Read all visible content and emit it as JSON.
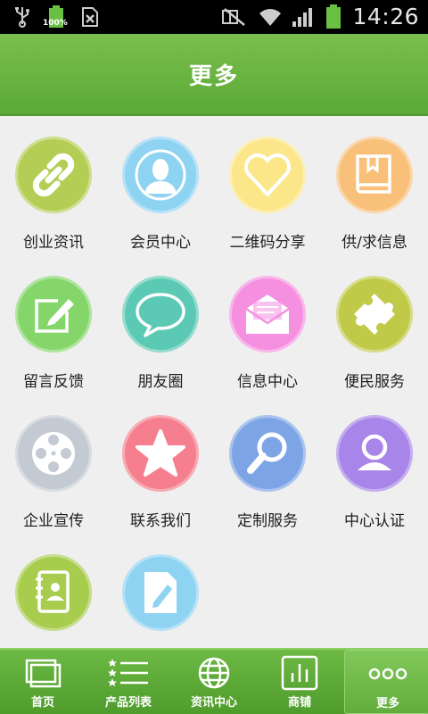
{
  "status_bar": {
    "time": "14:26",
    "battery_label": "100%",
    "icons": [
      "usb-icon",
      "battery-full-icon",
      "sim-card-icon",
      "mute-icon",
      "wifi-icon",
      "signal-icon",
      "battery-icon"
    ]
  },
  "header": {
    "title": "更多"
  },
  "grid": {
    "items": [
      {
        "label": "创业资讯",
        "icon": "chain-link-icon",
        "color": "#b4cd54"
      },
      {
        "label": "会员中心",
        "icon": "user-silhouette-icon",
        "color": "#8fd3f2"
      },
      {
        "label": "二维码分享",
        "icon": "heart-icon",
        "color": "#fbe78a"
      },
      {
        "label": "供/求信息",
        "icon": "book-icon",
        "color": "#f9c07a"
      },
      {
        "label": "留言反馈",
        "icon": "edit-note-icon",
        "color": "#84d66a"
      },
      {
        "label": "朋友圈",
        "icon": "chat-bubble-icon",
        "color": "#5cc9b4"
      },
      {
        "label": "信息中心",
        "icon": "envelope-icon",
        "color": "#f58fe0"
      },
      {
        "label": "便民服务",
        "icon": "puzzle-icon",
        "color": "#c0c948"
      },
      {
        "label": "企业宣传",
        "icon": "film-reel-icon",
        "color": "#c3cad3"
      },
      {
        "label": "联系我们",
        "icon": "star-icon",
        "color": "#f57f8e"
      },
      {
        "label": "定制服务",
        "icon": "magnifier-icon",
        "color": "#7da5e6"
      },
      {
        "label": "中心认证",
        "icon": "user-avatar-icon",
        "color": "#a885e8"
      },
      {
        "label": "",
        "icon": "contact-book-icon",
        "color": "#a8cc4e"
      },
      {
        "label": "",
        "icon": "document-edit-icon",
        "color": "#8fd3f2"
      }
    ]
  },
  "tab_bar": {
    "tabs": [
      {
        "label": "首页",
        "icon": "home-windows-icon",
        "active": false
      },
      {
        "label": "产品列表",
        "icon": "star-list-icon",
        "active": false
      },
      {
        "label": "资讯中心",
        "icon": "globe-icon",
        "active": false
      },
      {
        "label": "商铺",
        "icon": "bar-chart-icon",
        "active": false
      },
      {
        "label": "更多",
        "icon": "more-dots-icon",
        "active": true
      }
    ]
  }
}
